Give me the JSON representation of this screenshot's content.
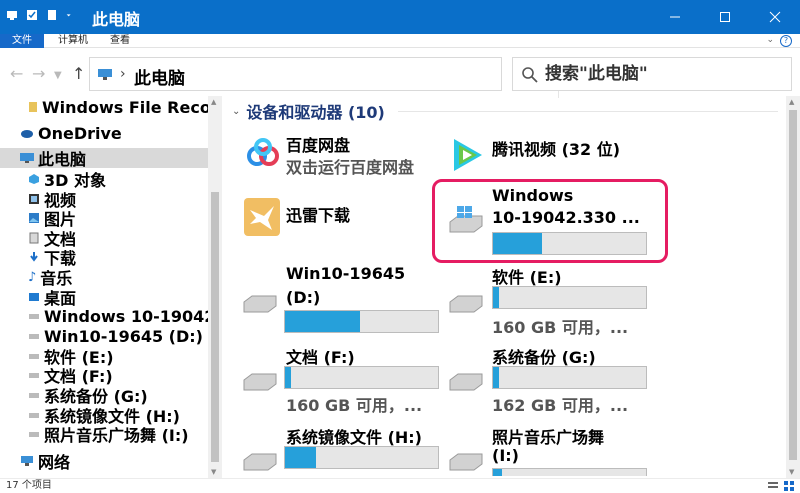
{
  "window": {
    "title": "此电脑"
  },
  "ribbon": {
    "tabs": [
      "文件",
      "计算机",
      "查看"
    ],
    "help": "?"
  },
  "address": {
    "crumb": "此电脑",
    "search_placeholder": "搜索\"此电脑\""
  },
  "nav": {
    "items": [
      "Windows File Reco",
      "OneDrive",
      "此电脑",
      "3D 对象",
      "视频",
      "图片",
      "文档",
      "下载",
      "音乐",
      "桌面",
      "Windows 10-19042",
      "Win10-19645 (D:)",
      "软件 (E:)",
      "文档 (F:)",
      "系统备份 (G:)",
      "系统镜像文件 (H:)",
      "照片音乐广场舞 (I:)",
      "网络"
    ]
  },
  "content": {
    "group_title": "设备和驱动器 (10)",
    "apps": [
      {
        "name": "百度网盘",
        "sub": "双击运行百度网盘"
      },
      {
        "name": "腾讯视频 (32 位)"
      },
      {
        "name": "迅雷下载"
      }
    ],
    "drives": [
      {
        "line1": "Windows",
        "line2": "10-19042.330 ...",
        "used_fraction": 0.32
      },
      {
        "line1": "Win10-19645",
        "line2": "(D:)",
        "used_fraction": 0.49
      },
      {
        "line1": "软件 (E:)",
        "free": "160 GB 可用，...",
        "used_fraction": 0.04
      },
      {
        "line1": "文档 (F:)",
        "free": "160 GB 可用，...",
        "used_fraction": 0.04
      },
      {
        "line1": "系统备份 (G:)",
        "free": "162 GB 可用，...",
        "used_fraction": 0.04
      },
      {
        "line1": "系统镜像文件 (H:)",
        "used_fraction": 0.2
      },
      {
        "line1": "照片音乐广场舞",
        "line2": "(I:)",
        "used_fraction": 0.06
      }
    ]
  },
  "status": {
    "count": "17 个项目"
  },
  "colors": {
    "titlebar": "#0a6fc9",
    "accent": "#1669c9",
    "bar_fill": "#26a0da",
    "highlight": "#e51c62"
  }
}
